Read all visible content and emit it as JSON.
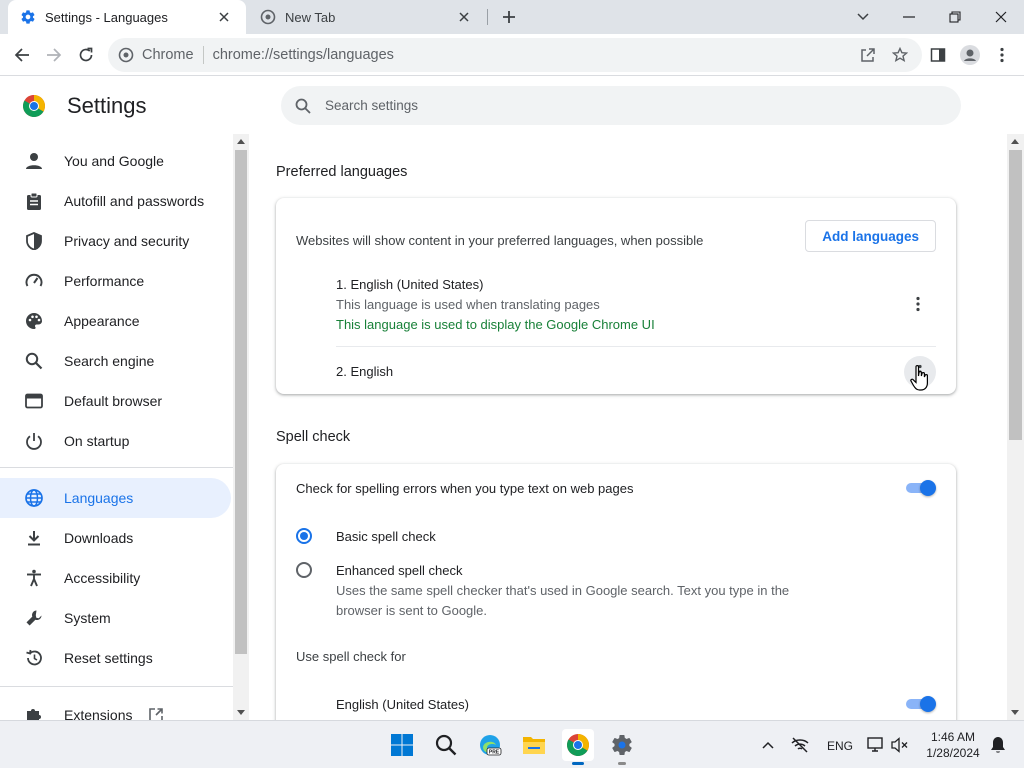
{
  "browser": {
    "tabs": [
      {
        "title": "Settings - Languages",
        "icon": "gear-icon",
        "active": true
      },
      {
        "title": "New Tab",
        "icon": "chrome-newtab-icon",
        "active": false
      }
    ],
    "omnibox": {
      "chip": "Chrome",
      "url": "chrome://settings/languages"
    }
  },
  "settings": {
    "title": "Settings",
    "search_placeholder": "Search settings",
    "nav": [
      {
        "label": "You and Google",
        "icon": "person-icon"
      },
      {
        "label": "Autofill and passwords",
        "icon": "clipboard-icon"
      },
      {
        "label": "Privacy and security",
        "icon": "shield-icon"
      },
      {
        "label": "Performance",
        "icon": "speedometer-icon"
      },
      {
        "label": "Appearance",
        "icon": "palette-icon"
      },
      {
        "label": "Search engine",
        "icon": "search-icon"
      },
      {
        "label": "Default browser",
        "icon": "browser-window-icon"
      },
      {
        "label": "On startup",
        "icon": "power-icon"
      },
      {
        "label": "Languages",
        "icon": "globe-icon",
        "active": true
      },
      {
        "label": "Downloads",
        "icon": "download-icon"
      },
      {
        "label": "Accessibility",
        "icon": "accessibility-icon"
      },
      {
        "label": "System",
        "icon": "wrench-icon"
      },
      {
        "label": "Reset settings",
        "icon": "reset-icon"
      },
      {
        "label": "Extensions",
        "icon": "puzzle-icon"
      }
    ]
  },
  "preferred": {
    "section_title": "Preferred languages",
    "description": "Websites will show content in your preferred languages, when possible",
    "add_button": "Add languages",
    "languages": [
      {
        "name": "1. English (United States)",
        "note1": "This language is used when translating pages",
        "note2": "This language is used to display the Google Chrome UI"
      },
      {
        "name": "2. English"
      }
    ]
  },
  "spell": {
    "section_title": "Spell check",
    "check_label": "Check for spelling errors when you type text on web pages",
    "check_enabled": true,
    "basic_label": "Basic spell check",
    "enhanced_label": "Enhanced spell check",
    "enhanced_desc1": "Uses the same spell checker that's used in Google search. Text you type in the",
    "enhanced_desc2": "browser is sent to Google.",
    "use_for_label": "Use spell check for",
    "languages": [
      {
        "name": "English (United States)",
        "enabled": true
      }
    ]
  },
  "taskbar": {
    "tray_language": "ENG",
    "time": "1:46 AM",
    "date": "1/28/2024"
  },
  "colors": {
    "accent": "#1a73e8",
    "ui_language_note": "#188038"
  }
}
